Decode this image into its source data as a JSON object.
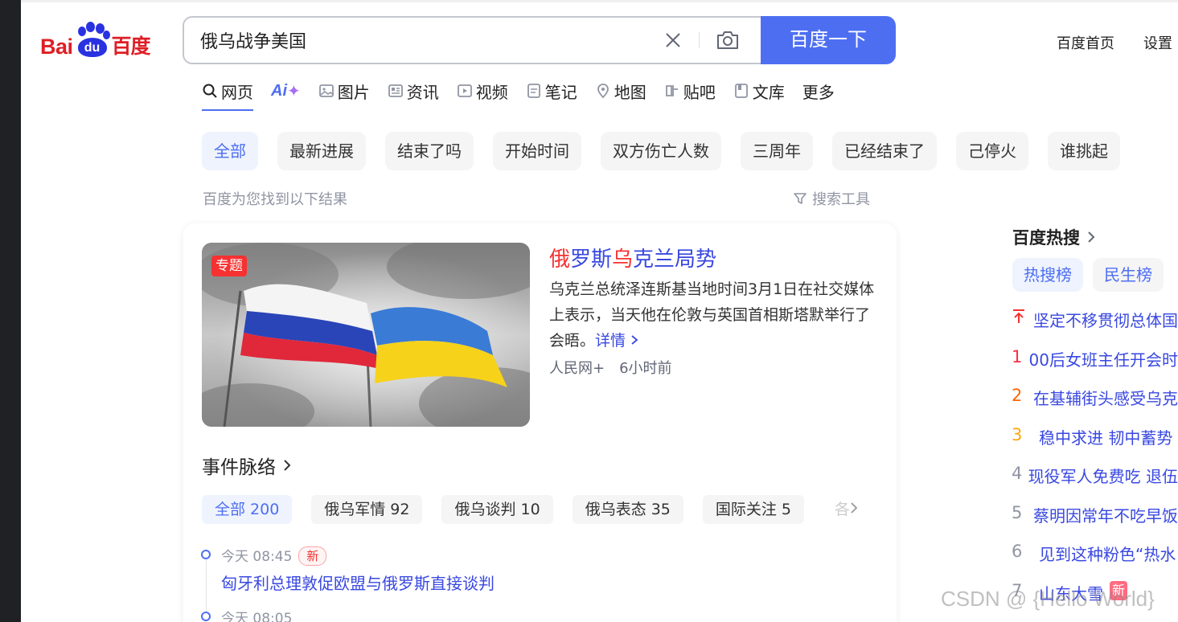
{
  "logo": {
    "latin_a": "Bai",
    "paw_text": "du",
    "chinese": "百度"
  },
  "search": {
    "query": "俄乌战争美国",
    "button_label": "百度一下"
  },
  "top_links": [
    "百度首页",
    "设置"
  ],
  "tabs": [
    {
      "label": "网页",
      "icon": "search-icon",
      "active": true
    },
    {
      "label": "Ai",
      "icon": "ai-icon"
    },
    {
      "label": "图片",
      "icon": "image-icon"
    },
    {
      "label": "资讯",
      "icon": "news-icon"
    },
    {
      "label": "视频",
      "icon": "video-icon"
    },
    {
      "label": "笔记",
      "icon": "note-icon"
    },
    {
      "label": "地图",
      "icon": "map-icon"
    },
    {
      "label": "贴吧",
      "icon": "tieba-icon"
    },
    {
      "label": "文库",
      "icon": "wenku-icon"
    },
    {
      "label": "更多"
    }
  ],
  "chips": [
    "全部",
    "最新进展",
    "结束了吗",
    "开始时间",
    "双方伤亡人数",
    "三周年",
    "已经结束了",
    "己停火",
    "谁挑起"
  ],
  "result_note": "百度为您找到以下结果",
  "tools_label": "搜索工具",
  "card": {
    "badge": "专题",
    "title_parts": [
      "俄",
      "罗斯",
      "乌",
      "克兰局势"
    ],
    "description": "乌克兰总统泽连斯基当地时间3月1日在社交媒体上表示，当天他在伦敦与英国首相斯塔默举行了会晤。",
    "more_link": "详情",
    "source": "人民网+",
    "time": "6小时前",
    "events_title": "事件脉络",
    "event_chips": [
      {
        "label": "全部",
        "count": "200"
      },
      {
        "label": "俄乌军情",
        "count": "92"
      },
      {
        "label": "俄乌谈判",
        "count": "10"
      },
      {
        "label": "俄乌表态",
        "count": "35"
      },
      {
        "label": "国际关注",
        "count": "5"
      }
    ],
    "event_more": "各",
    "timeline": [
      {
        "time": "今天 08:45",
        "badge": "新",
        "text": "匈牙利总理敦促欧盟与俄罗斯直接谈判"
      },
      {
        "time": "今天 08:05",
        "badge": "",
        "text": ""
      }
    ]
  },
  "hot": {
    "title": "百度热搜",
    "tabs": [
      "热搜榜",
      "民生榜"
    ],
    "items": [
      {
        "rank": "",
        "text": "坚定不移贯彻总体国"
      },
      {
        "rank": "1",
        "text": "00后女班主任开会时"
      },
      {
        "rank": "2",
        "text": "在基辅街头感受乌克"
      },
      {
        "rank": "3",
        "text": "稳中求进 韧中蓄势"
      },
      {
        "rank": "4",
        "text": "现役军人免费吃 退伍"
      },
      {
        "rank": "5",
        "text": "蔡明因常年不吃早饭"
      },
      {
        "rank": "6",
        "text": "见到这种粉色“热水"
      },
      {
        "rank": "7",
        "text": "山东大雪",
        "badge": "新"
      }
    ]
  },
  "watermark": "CSDN @ {Hello World}",
  "colors": {
    "accent": "#4e6ef2",
    "link": "#3948e0",
    "red": "#f73131"
  }
}
